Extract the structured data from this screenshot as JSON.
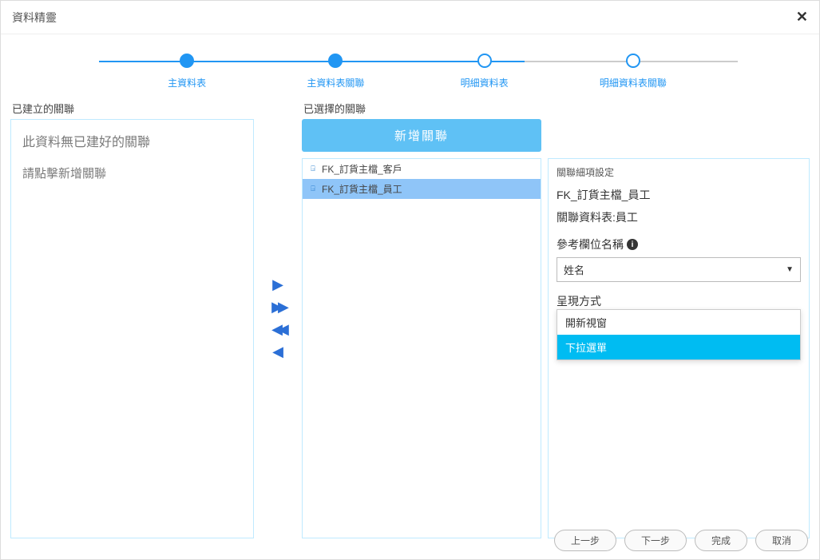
{
  "title": "資料精靈",
  "steps": [
    {
      "label": "主資料表",
      "filled": true
    },
    {
      "label": "主資料表關聯",
      "filled": true
    },
    {
      "label": "明細資料表",
      "filled": false
    },
    {
      "label": "明細資料表關聯",
      "filled": false
    }
  ],
  "left": {
    "header": "已建立的關聯",
    "empty_line1": "此資料無已建好的關聯",
    "empty_line2": "請點擊新增關聯"
  },
  "right": {
    "header": "已選擇的關聯",
    "add_button": "新增關聯",
    "list": [
      {
        "label": "FK_訂貨主檔_客戶",
        "selected": false
      },
      {
        "label": "FK_訂貨主檔_員工",
        "selected": true
      }
    ]
  },
  "detail": {
    "panel_title": "關聯細項設定",
    "fk_name": "FK_訂貨主檔_員工",
    "related_table_label": "關聯資料表:員工",
    "ref_field_label": "參考欄位名稱",
    "ref_field_value": "姓名",
    "display_mode_label": "呈現方式",
    "display_mode_value": "下拉選單",
    "dropdown_options": [
      {
        "label": "開新視窗",
        "highlight": false
      },
      {
        "label": "下拉選單",
        "highlight": true
      }
    ]
  },
  "footer": {
    "prev": "上一步",
    "next": "下一步",
    "finish": "完成",
    "cancel": "取消"
  }
}
